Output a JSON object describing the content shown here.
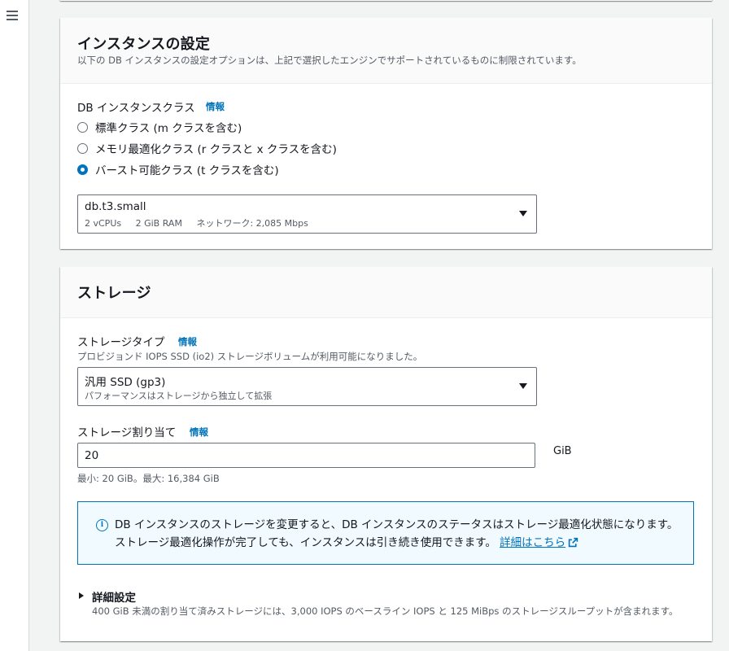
{
  "nav": {
    "menu_icon": "hamburger-menu-icon"
  },
  "instance": {
    "title": "インスタンスの設定",
    "description": "以下の DB インスタンスの設定オプションは、上記で選択したエンジンでサポートされているものに制限されています。",
    "class_label": "DB インスタンスクラス",
    "info": "情報",
    "options": [
      {
        "label": "標準クラス (m クラスを含む)",
        "checked": false
      },
      {
        "label": "メモリ最適化クラス (r クラスと x クラスを含む)",
        "checked": false
      },
      {
        "label": "バースト可能クラス (t クラスを含む)",
        "checked": true
      }
    ],
    "selected_class": "db.t3.small",
    "specs": {
      "vcpu": "2 vCPUs",
      "ram": "2 GiB RAM",
      "network": "ネットワーク: 2,085 Mbps"
    }
  },
  "storage": {
    "title": "ストレージ",
    "type_label": "ストレージタイプ",
    "info": "情報",
    "type_note": "プロビジョンド IOPS SSD (io2) ストレージボリュームが利用可能になりました。",
    "type_value": "汎用 SSD (gp3)",
    "type_desc": "パフォーマンスはストレージから独立して拡張",
    "alloc_label": "ストレージ割り当て",
    "alloc_value": "20",
    "alloc_unit": "GiB",
    "alloc_constraint": "最小: 20 GiB。最大: 16,384 GiB",
    "alert_text": "DB インスタンスのストレージを変更すると、DB インスタンスのステータスはストレージ最適化状態になります。ストレージ最適化操作が完了しても、インスタンスは引き続き使用できます。",
    "alert_link": "詳細はこちら",
    "advanced_label": "詳細設定",
    "advanced_desc": "400 GiB 未満の割り当て済みストレージには、3,000 IOPS のベースライン IOPS と 125 MiBps のストレージスループットが含まれます。"
  },
  "colors": {
    "link": "#0073bb",
    "alert_bg": "#f1faff",
    "page_bg": "#f2f3f3"
  }
}
